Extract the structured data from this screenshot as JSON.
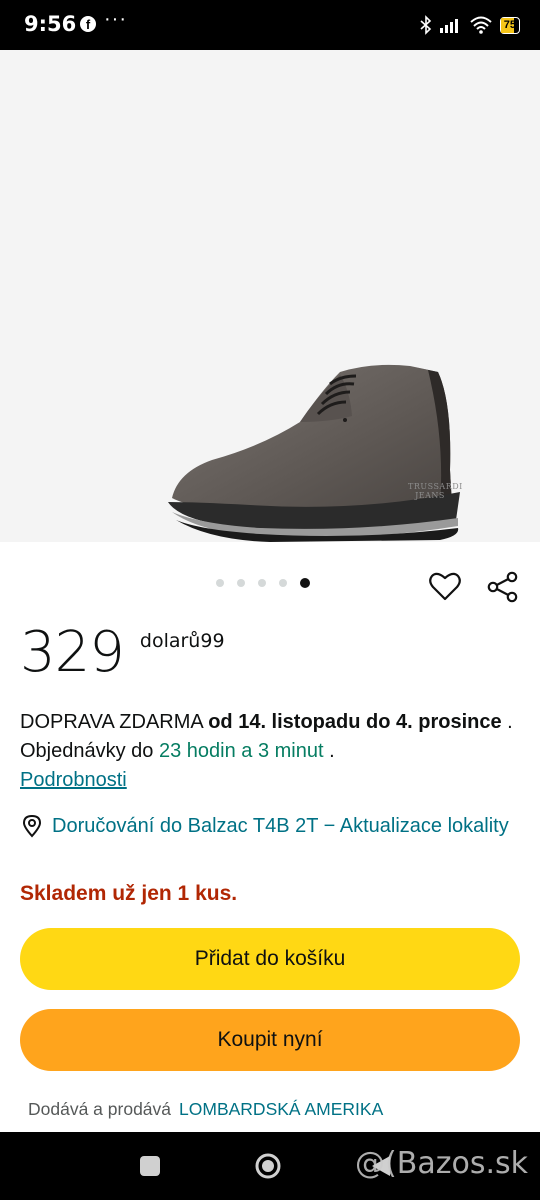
{
  "status_bar": {
    "time": "9:56",
    "facebook_glyph": "f",
    "more": "···",
    "battery": "75",
    "battery_level": 0.75,
    "icons": [
      "facebook-icon",
      "bluetooth-icon",
      "signal-icon",
      "wifi-icon",
      "battery-icon"
    ]
  },
  "product": {
    "image_alt": "TRUSSARDI JEANS grey suede chukka boot",
    "image_brand_text": "TRUSSARDI JEANS",
    "carousel": {
      "count": 5,
      "active_index": 4
    }
  },
  "price": {
    "amount": "329",
    "currency": "dolarů99"
  },
  "delivery": {
    "free_shipping": "DOPRAVA ZDARMA",
    "date_range": "od 14. listopadu do 4. prosince",
    "order_within": ". Objednávky do",
    "countdown": "23 hodin a 3 minut",
    "period": ".",
    "details_link": "Podrobnosti"
  },
  "location": {
    "text": "Doručování do Balzac T4B 2T − Aktualizace lokality"
  },
  "stock": {
    "text": "Skladem už jen 1 kus."
  },
  "buttons": {
    "add_to_cart": "Přidat do košíku",
    "buy_now": "Koupit nyní"
  },
  "seller": {
    "label": "Dodává a prodává",
    "name": "LOMBARDSKÁ AMERIKA"
  },
  "watermark": "@(Bazos.sk",
  "colors": {
    "cart_button": "#ffd814",
    "buy_button": "#ffa41c",
    "link": "#007185",
    "stock_warning": "#b12704",
    "countdown": "#067d62"
  }
}
